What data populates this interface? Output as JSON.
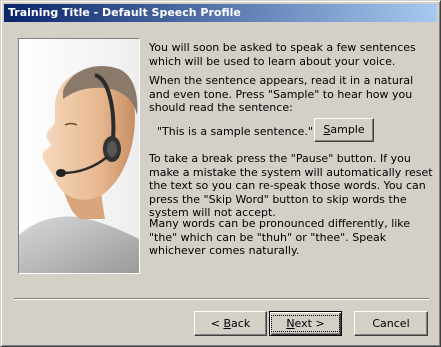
{
  "window": {
    "title": "Training Title - Default Speech Profile"
  },
  "content": {
    "paragraph1": "You will soon be asked to speak a few sentences which will be used to learn about your voice.",
    "paragraph2": "When the sentence appears, read it in a natural and even tone. Press \"Sample\" to hear how you should read the sentence:",
    "sample_sentence": "\"This is a sample sentence.\"",
    "paragraph3": "To take a break press the \"Pause\" button. If you make a mistake the system will automatically reset the text so you can re-speak those words. You can press the \"Skip Word\" button to skip words the system will not accept.",
    "paragraph4": "Many words can be pronounced differently, like \"the\" which can be \"thuh\" or \"thee\". Speak whichever comes naturally."
  },
  "buttons": {
    "sample": {
      "mnemonic": "S",
      "rest": "ample"
    },
    "back": {
      "prefix": "< ",
      "mnemonic": "B",
      "rest": "ack"
    },
    "next": {
      "mnemonic": "N",
      "rest": "ext >"
    },
    "cancel": {
      "label": "Cancel"
    }
  },
  "colors": {
    "dialog_face": "#d4d0c8",
    "titlebar_start": "#0a246a",
    "titlebar_end": "#a6caf0",
    "illustration_bg": "#ffffff"
  },
  "icons": {
    "illustration": "headset-user-illustration"
  }
}
